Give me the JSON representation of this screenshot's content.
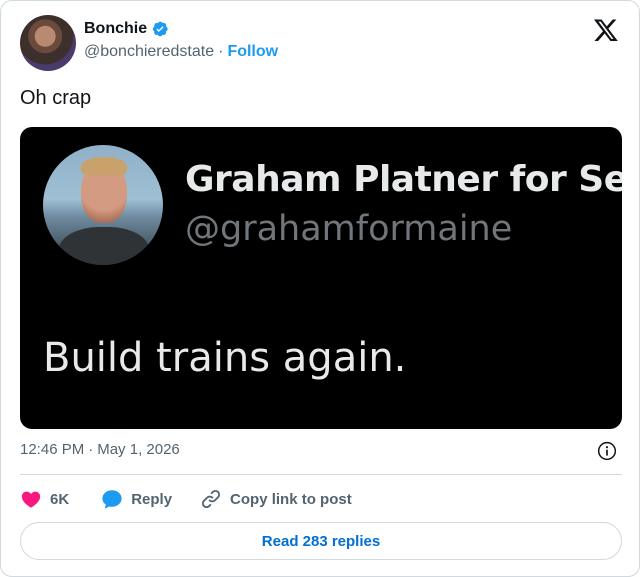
{
  "author": {
    "display_name": "Bonchie",
    "handle": "@bonchieredstate",
    "separator": "·",
    "follow_label": "Follow",
    "verified": true
  },
  "tweet": {
    "text": "Oh crap",
    "timestamp": "12:46 PM",
    "separator": "·",
    "date": "May 1, 2026"
  },
  "embedded_post": {
    "display_name": "Graham Platner for Ser",
    "handle": "@grahamformaine",
    "text": "Build trains again."
  },
  "actions": {
    "like_count": "6K",
    "reply_label": "Reply",
    "copy_link_label": "Copy link to post"
  },
  "footer": {
    "read_replies_label": "Read 283 replies"
  },
  "icons": {
    "brand": "x-logo-icon",
    "verified": "verified-badge-icon",
    "info": "info-icon",
    "like": "heart-icon",
    "reply": "speech-bubble-icon",
    "copy": "link-icon"
  },
  "colors": {
    "accent": "#1d9bf0",
    "like": "#f91880",
    "link": "#006fd6",
    "muted": "#536471"
  }
}
